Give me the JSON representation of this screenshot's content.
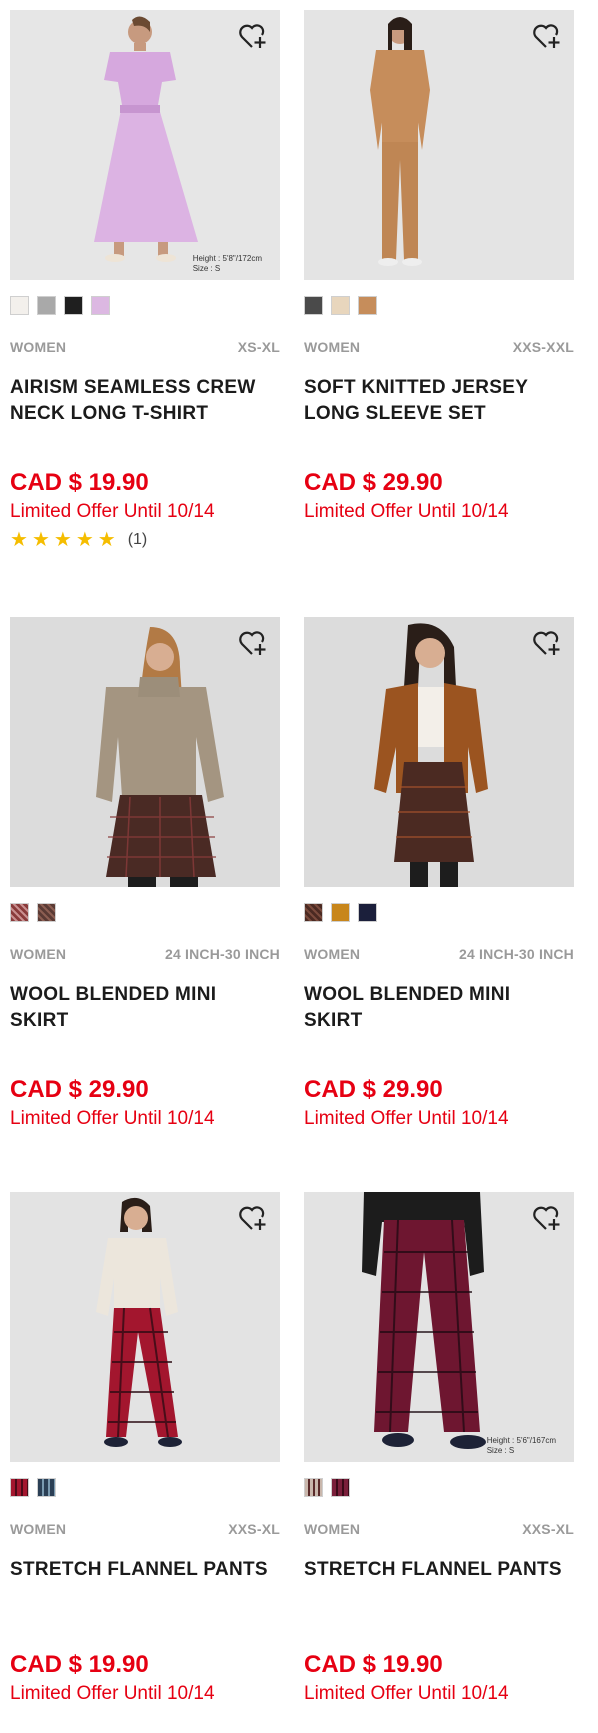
{
  "products": [
    {
      "category": "WOMEN",
      "size_range": "XS-XL",
      "name": "AIRISM SEAMLESS CREW NECK LONG T-SHIRT",
      "price": "CAD $ 19.90",
      "offer": "Limited Offer Until 10/14",
      "caption": "Height : 5'8\"/172cm\nSize : S",
      "swatches": [
        "#f3f0ec",
        "#a9a9a9",
        "#1f1f1f",
        "#dcb8e2"
      ],
      "rating_stars": 5,
      "rating_count": "(1)",
      "photo_bg": "#e6e6e6"
    },
    {
      "category": "WOMEN",
      "size_range": "XXS-XXL",
      "name": "SOFT KNITTED JERSEY LONG SLEEVE SET",
      "price": "CAD $ 29.90",
      "offer": "Limited Offer Until 10/14",
      "caption": "",
      "swatches": [
        "#4a4a4a",
        "#e8d6bd",
        "#c68d5b"
      ],
      "photo_bg": "#e4e4e4"
    },
    {
      "category": "WOMEN",
      "size_range": "24 INCH-30 INCH",
      "name": "WOOL BLENDED MINI SKIRT",
      "price": "CAD $ 29.90",
      "offer": "Limited Offer Until 10/14",
      "caption": "",
      "swatches": [
        "#8a3b3b",
        "#5a3a34"
      ],
      "photo_bg": "#dcdcdc"
    },
    {
      "category": "WOMEN",
      "size_range": "24 INCH-30 INCH",
      "name": "WOOL BLENDED MINI SKIRT",
      "price": "CAD $ 29.90",
      "offer": "Limited Offer Until 10/14",
      "caption": "",
      "swatches": [
        "#4b2a22",
        "#c8861b",
        "#1b1f3b"
      ],
      "photo_bg": "#dcdcdc"
    },
    {
      "category": "WOMEN",
      "size_range": "XXS-XL",
      "name": "STRETCH FLANNEL PANTS",
      "price": "CAD $ 19.90",
      "offer": "Limited Offer Until 10/14",
      "caption": "",
      "swatches": [
        "#a3162e",
        "#2b3f55"
      ],
      "photo_bg": "#e3e3e3"
    },
    {
      "category": "WOMEN",
      "size_range": "XXS-XL",
      "name": "STRETCH FLANNEL PANTS",
      "price": "CAD $ 19.90",
      "offer": "Limited Offer Until 10/14",
      "caption": "Height : 5'6\"/167cm\nSize : S",
      "swatches": [
        "#c9b7ac",
        "#7a1f3a"
      ],
      "photo_bg": "#e3e3e3"
    }
  ],
  "icons": {
    "wishlist": "heart-plus-icon",
    "star": "star-icon"
  },
  "colors": {
    "price": "#e60012",
    "star": "#f5bd00"
  }
}
